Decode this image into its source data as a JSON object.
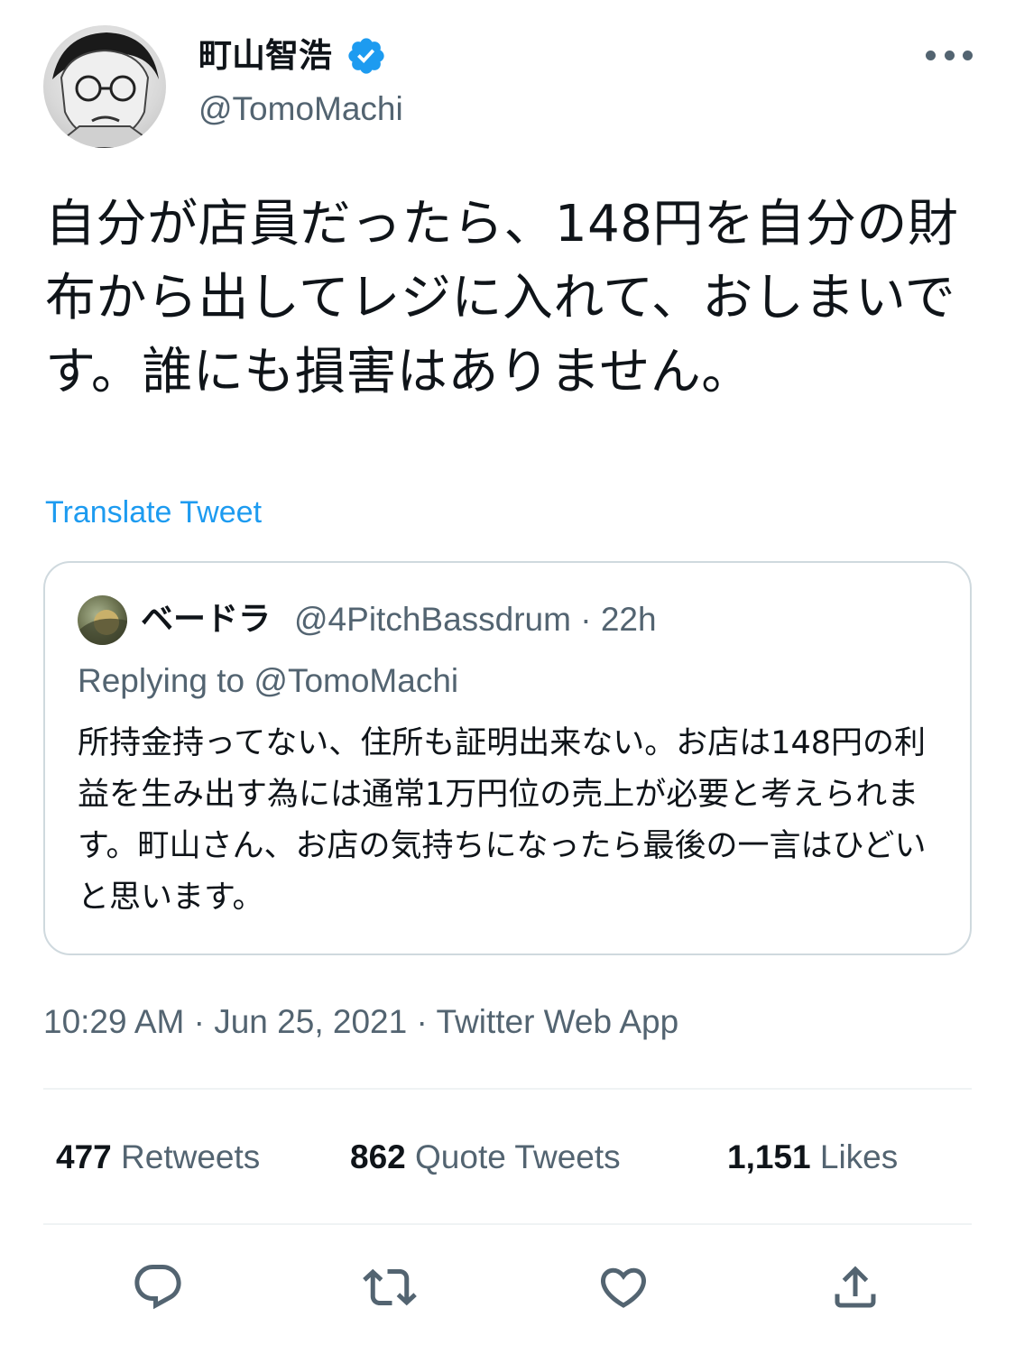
{
  "author": {
    "display_name": "町山智浩",
    "handle": "@TomoMachi",
    "verified_icon": "verified-badge-icon",
    "avatar_icon": "avatar"
  },
  "tweet": {
    "text": "自分が店員だったら、148円を自分の財布から出してレジに入れて、おしまいです。誰にも損害はありません。",
    "translate_label": "Translate Tweet"
  },
  "quoted_tweet": {
    "display_name": "ベードラ",
    "handle": "@4PitchBassdrum",
    "separator": "·",
    "time_ago": "22h",
    "replying_prefix": "Replying to",
    "replying_handle": "@TomoMachi",
    "text": "所持金持ってない、住所も証明出来ない。お店は148円の利益を生み出す為には通常1万円位の売上が必要と考えられます。町山さん、お店の気持ちになったら最後の一言はひどいと思います。"
  },
  "meta": {
    "time": "10:29 AM",
    "date": "Jun 25, 2021",
    "separator": "·",
    "source": "Twitter Web App"
  },
  "stats": {
    "retweets_count": "477",
    "retweets_label": "Retweets",
    "quotes_count": "862",
    "quotes_label": "Quote Tweets",
    "likes_count": "1,151",
    "likes_label": "Likes"
  },
  "actions": [
    "reply-icon",
    "retweet-icon",
    "like-icon",
    "share-icon"
  ],
  "colors": {
    "accent": "#1d9bf0",
    "text_primary": "#0f1419",
    "text_secondary": "#536471",
    "border": "#cfd9de",
    "divider": "#eff3f4"
  }
}
